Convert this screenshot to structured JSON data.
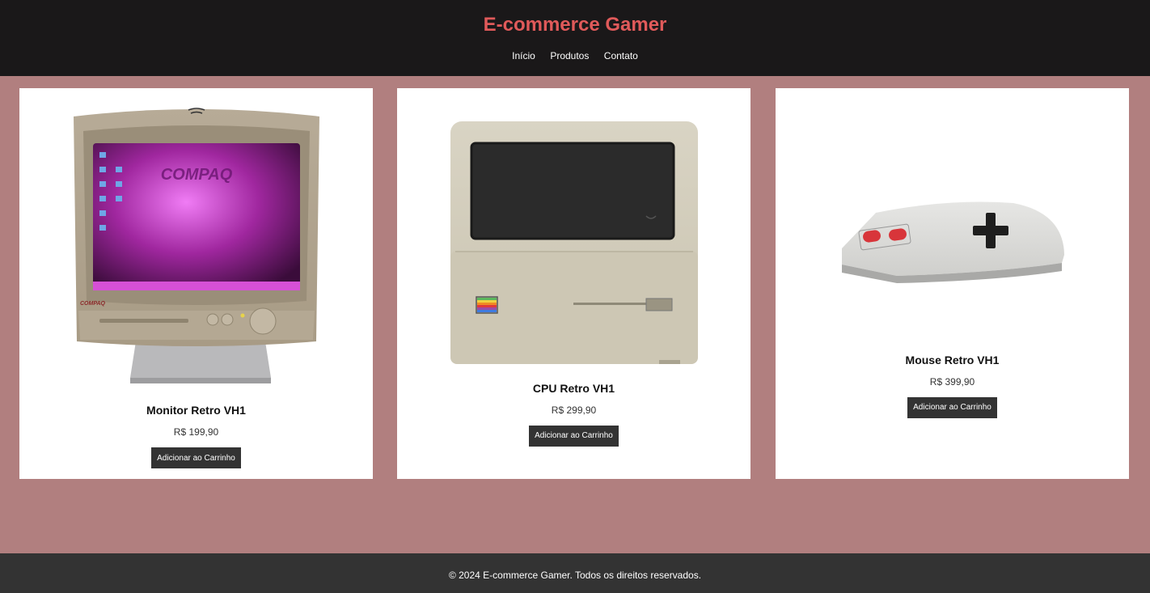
{
  "header": {
    "title": "E-commerce Gamer",
    "nav": [
      "Início",
      "Produtos",
      "Contato"
    ]
  },
  "products": [
    {
      "name": "Monitor Retro VH1",
      "price": "R$ 199,90",
      "button": "Adicionar ao Carrinho",
      "image_icon": "crt-monitor-image"
    },
    {
      "name": "CPU Retro VH1",
      "price": "R$ 299,90",
      "button": "Adicionar ao Carrinho",
      "image_icon": "retro-computer-image"
    },
    {
      "name": "Mouse Retro VH1",
      "price": "R$ 399,90",
      "button": "Adicionar ao Carrinho",
      "image_icon": "gamepad-mouse-image"
    }
  ],
  "footer": {
    "text": "© 2024 E-commerce Gamer. Todos os direitos reservados."
  },
  "colors": {
    "header_bg": "#1a1819",
    "title": "#e05a5a",
    "page_bg": "#b17f7f",
    "button_bg": "#333333",
    "footer_bg": "#333333"
  }
}
